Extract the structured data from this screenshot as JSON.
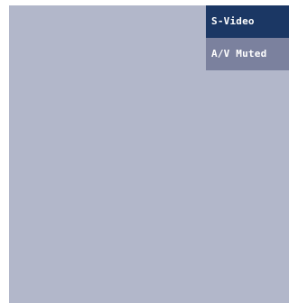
{
  "display": {
    "background_color": "#b2b7ca"
  },
  "osd": {
    "input_source": "S-Video",
    "status": "A/V Muted",
    "colors": {
      "input_bg": "#1b3764",
      "status_bg": "#7b819e",
      "text": "#ffffff"
    }
  }
}
